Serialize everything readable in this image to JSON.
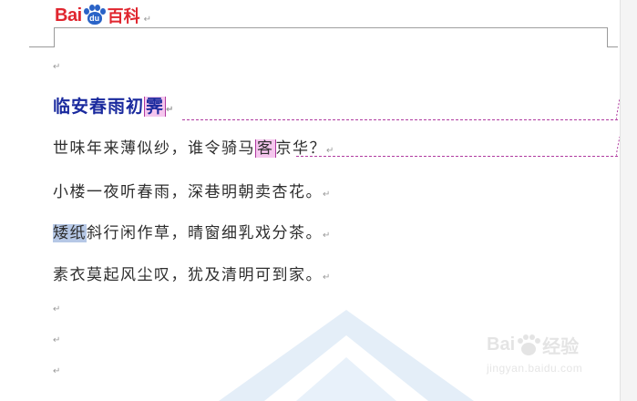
{
  "header": {
    "logo_latin": "Bai",
    "logo_paw": "du",
    "logo_cn": "百科",
    "para_mark": "↵"
  },
  "document": {
    "para_mark": "↵",
    "title_main": "临安春雨初",
    "title_highlight": "霁",
    "lines": [
      {
        "before": "世味年来薄似纱，谁令骑马",
        "highlight": "客",
        "after": "京华？"
      },
      {
        "text": "小楼一夜听春雨，深巷明朝卖杏花。"
      },
      {
        "highlight": "矮纸",
        "after": "斜行闲作草，晴窗细乳戏分茶。"
      },
      {
        "text": "素衣莫起风尘叹，犹及清明可到家。"
      }
    ]
  },
  "watermark": {
    "main_a": "Bai",
    "main_b": "经验",
    "url": "jingyan.baidu.com"
  },
  "colors": {
    "title": "#1a2a9e",
    "highlight_pink": "#f5c6ee",
    "highlight_blue": "#b6c8e6",
    "comment_line": "#b03aa0",
    "logo_red": "#e0262f",
    "logo_blue": "#2a63c7"
  }
}
